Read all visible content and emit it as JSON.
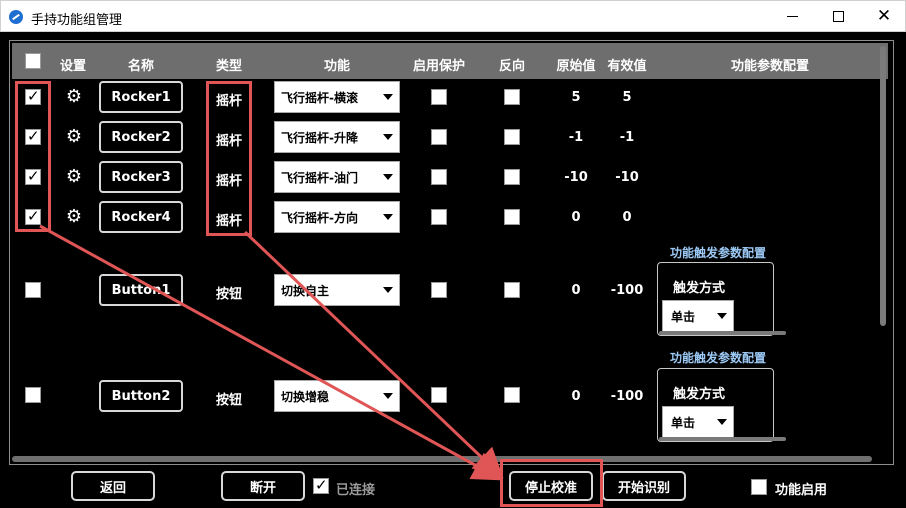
{
  "window": {
    "title": "手持功能组管理",
    "min_icon": "minimize-icon",
    "max_icon": "maximize-icon",
    "close_icon": "close-icon",
    "close_glyph": "✕"
  },
  "headers": {
    "settings": "设置",
    "name": "名称",
    "type": "类型",
    "function": "功能",
    "protect": "启用保护",
    "reverse": "反向",
    "raw": "原始值",
    "effective": "有效值",
    "param_config": "功能参数配置"
  },
  "rows": [
    {
      "checked": true,
      "name": "Rocker1",
      "type": "摇杆",
      "function": "飞行摇杆-横滚",
      "raw": "5",
      "effective": "5"
    },
    {
      "checked": true,
      "name": "Rocker2",
      "type": "摇杆",
      "function": "飞行摇杆-升降",
      "raw": "-1",
      "effective": "-1"
    },
    {
      "checked": true,
      "name": "Rocker3",
      "type": "摇杆",
      "function": "飞行摇杆-油门",
      "raw": "-10",
      "effective": "-10"
    },
    {
      "checked": true,
      "name": "Rocker4",
      "type": "摇杆",
      "function": "飞行摇杆-方向",
      "raw": "0",
      "effective": "0"
    },
    {
      "checked": false,
      "name": "Button1",
      "type": "按钮",
      "function": "切换自主",
      "raw": "0",
      "effective": "-100",
      "param": {
        "title": "功能触发参数配置",
        "trigger_label": "触发方式",
        "trigger_value": "单击"
      }
    },
    {
      "checked": false,
      "name": "Button2",
      "type": "按钮",
      "function": "切换增稳",
      "raw": "0",
      "effective": "-100",
      "param": {
        "title": "功能触发参数配置",
        "trigger_label": "触发方式",
        "trigger_value": "单击"
      }
    }
  ],
  "gear_glyph": "⚙",
  "bottom": {
    "back": "返回",
    "disconnect": "断开",
    "connected": "已连接",
    "stop_calibration": "停止校准",
    "start_recognition": "开始识别",
    "function_enable": "功能启用"
  },
  "annotation_color": "#e05555"
}
